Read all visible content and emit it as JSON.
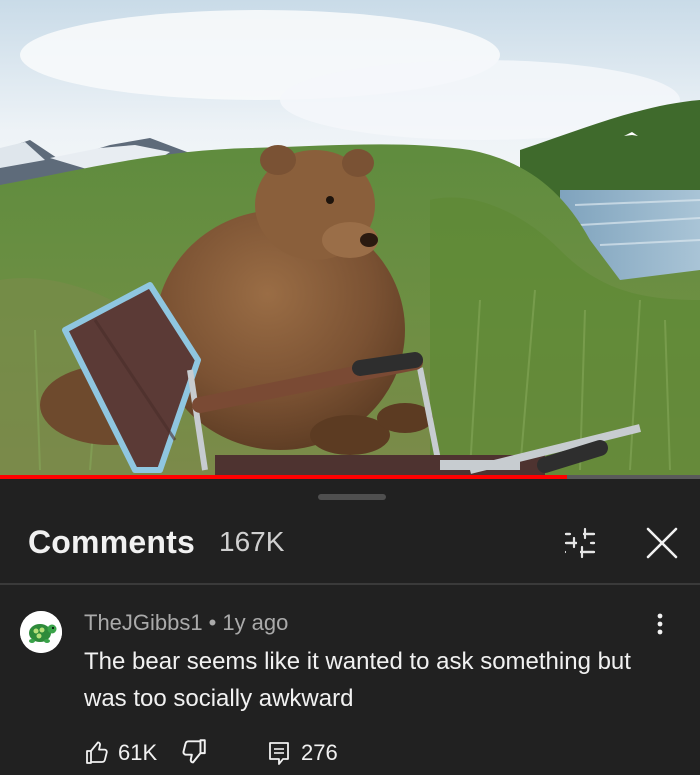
{
  "video": {
    "progress_fraction": 0.81
  },
  "comments_header": {
    "title": "Comments",
    "count": "167K"
  },
  "comment": {
    "author": "TheJGibbs1",
    "separator": "•",
    "age": "1y ago",
    "text": "The bear seems like it wanted to ask something but was too socially awkward",
    "likes": "61K",
    "replies": "276"
  },
  "icons": {
    "filter": "sort-filter-icon",
    "close": "close-icon",
    "more": "more-vertical-icon",
    "like": "thumbs-up-icon",
    "dislike": "thumbs-down-icon",
    "reply": "reply-icon"
  },
  "colors": {
    "background": "#212121",
    "progress": "#ff0000",
    "text_primary": "#f1f1f1",
    "text_secondary": "#aaaaaa"
  }
}
